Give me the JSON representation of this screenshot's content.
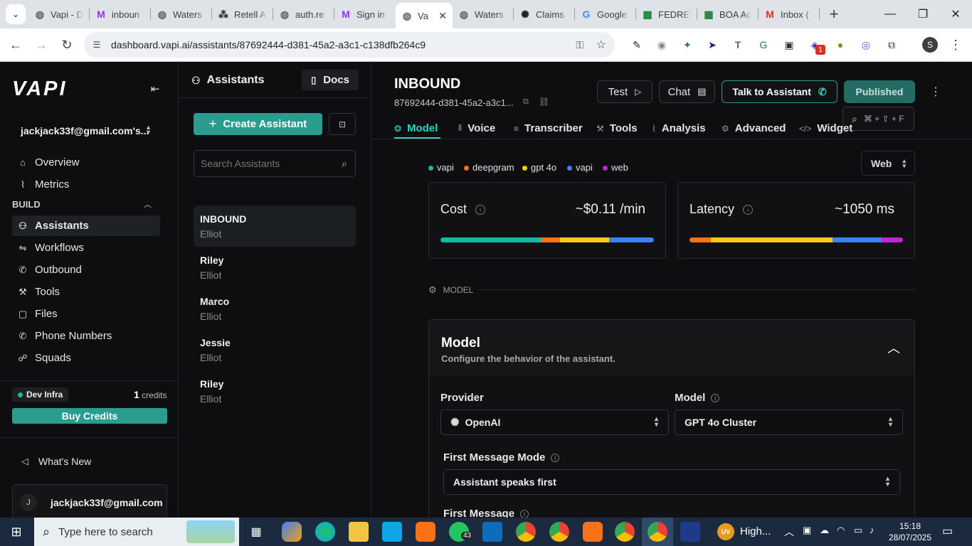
{
  "browser": {
    "tabs": [
      {
        "label": "Vapi - D",
        "icon": "globe-icon"
      },
      {
        "label": "inboun",
        "icon": "retell-icon"
      },
      {
        "label": "Waters",
        "icon": "globe-icon"
      },
      {
        "label": "Retell A",
        "icon": "retell-grid-icon"
      },
      {
        "label": "auth.re",
        "icon": "globe-icon"
      },
      {
        "label": "Sign in",
        "icon": "retell-icon"
      },
      {
        "label": "Va",
        "icon": "globe-icon",
        "active": true
      },
      {
        "label": "Waters",
        "icon": "globe-icon"
      },
      {
        "label": "Claims",
        "icon": "openai-icon"
      },
      {
        "label": "Google",
        "icon": "google-icon"
      },
      {
        "label": "FEDREV",
        "icon": "sheets-icon"
      },
      {
        "label": "BOA Ac",
        "icon": "sheets-icon"
      },
      {
        "label": "Inbox (",
        "icon": "gmail-icon"
      }
    ],
    "url": "dashboard.vapi.ai/assistants/87692444-d381-45a2-a3c1-c138dfb264c9",
    "ext_badge": "1",
    "profile_initial": "S"
  },
  "sidebar": {
    "logo": "VAPI",
    "account": "jackjack33f@gmail.com's...",
    "top_items": [
      {
        "label": "Overview",
        "icon": "home-icon"
      },
      {
        "label": "Metrics",
        "icon": "chart-icon"
      }
    ],
    "section": "BUILD",
    "items": [
      {
        "label": "Assistants",
        "icon": "user-icon",
        "selected": true
      },
      {
        "label": "Workflows",
        "icon": "workflow-icon"
      },
      {
        "label": "Outbound",
        "icon": "phone-icon"
      },
      {
        "label": "Tools",
        "icon": "wrench-icon"
      },
      {
        "label": "Files",
        "icon": "file-icon"
      },
      {
        "label": "Phone Numbers",
        "icon": "phone-icon"
      },
      {
        "label": "Squads",
        "icon": "squads-icon"
      }
    ],
    "org": "Dev Infra",
    "credits_value": "1",
    "credits_label": "credits",
    "buy_credits": "Buy Credits",
    "whats_new": "What's New",
    "user_initial": "J",
    "user_email": "jackjack33f@gmail.com"
  },
  "list": {
    "title": "Assistants",
    "docs": "Docs",
    "create": "Create Assistant",
    "search_placeholder": "Search Assistants",
    "assistants": [
      {
        "name": "INBOUND",
        "sub": "Elliot",
        "selected": true
      },
      {
        "name": "Riley",
        "sub": "Elliot"
      },
      {
        "name": "Marco",
        "sub": "Elliot"
      },
      {
        "name": "Jessie",
        "sub": "Elliot"
      },
      {
        "name": "Riley",
        "sub": "Elliot"
      }
    ]
  },
  "main": {
    "title": "INBOUND",
    "id": "87692444-d381-45a2-a3c1...",
    "test": "Test",
    "chat": "Chat",
    "talk": "Talk to Assistant",
    "published": "Published",
    "shortcut": "⌘ + ⇧ + F",
    "tabs": [
      {
        "label": "Model",
        "icon": "brain-icon",
        "active": true
      },
      {
        "label": "Voice",
        "icon": "wave-icon"
      },
      {
        "label": "Transcriber",
        "icon": "lines-icon"
      },
      {
        "label": "Tools",
        "icon": "wrench-icon"
      },
      {
        "label": "Analysis",
        "icon": "chart-icon"
      },
      {
        "label": "Advanced",
        "icon": "gear-icon"
      },
      {
        "label": "Widget",
        "icon": "code-icon"
      }
    ],
    "legend": [
      {
        "label": "vapi",
        "color": "#14b8a6"
      },
      {
        "label": "deepgram",
        "color": "#f97316"
      },
      {
        "label": "gpt 4o",
        "color": "#facc15"
      },
      {
        "label": "vapi",
        "color": "#3b82f6"
      },
      {
        "label": "web",
        "color": "#c026d3"
      }
    ],
    "channel": "Web",
    "cost": {
      "label": "Cost",
      "value": "~$0.11 /min",
      "segments": [
        0.47,
        0.09,
        0.23,
        0.21
      ]
    },
    "latency": {
      "label": "Latency",
      "value": "~1050 ms",
      "segments": [
        0.1,
        0.57,
        0.23,
        0.1
      ]
    },
    "section_label": "MODEL",
    "model_card": {
      "title": "Model",
      "subtitle": "Configure the behavior of the assistant.",
      "provider_label": "Provider",
      "provider_value": "OpenAI",
      "model_label": "Model",
      "model_value": "GPT 4o Cluster",
      "fmm_label": "First Message Mode",
      "fmm_value": "Assistant speaks first",
      "fm_label": "First Message"
    }
  },
  "taskbar": {
    "search": "Type here to search",
    "badge": "43",
    "weather": "High...",
    "time": "15:18",
    "date": "28/07/2025"
  }
}
